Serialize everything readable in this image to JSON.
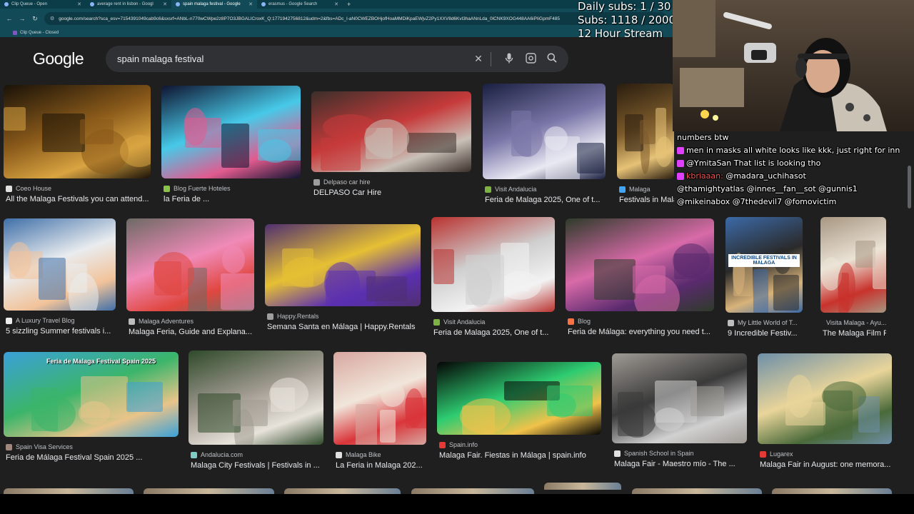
{
  "browser": {
    "tabs": [
      {
        "label": "Clip Queue - Open",
        "active": false
      },
      {
        "label": "average rent in lisbon - Googl",
        "active": false
      },
      {
        "label": "spain malaga festival - Google",
        "active": true
      },
      {
        "label": "erasmus - Google Search",
        "active": false
      }
    ],
    "new_tab": "+",
    "url": "google.com/search?sca_esv=7154391049cab9c6&sxsrf=ANbL-n770wCWpe2z8P7O3JBGALICroxK_Q:1771942756812&udm=2&fbs=ADc_l-aN0CWEZBOHjofHoaMMDiKpaEWjvZ2Py1XXV8d6Kvl3haANnLda_0lCNK9XOG448AA6iPIiGpmF485",
    "bookmark": "Clip Queue - Closed"
  },
  "google": {
    "logo": "Google",
    "query": "spain malaga festival",
    "icons": {
      "clear": "close-icon",
      "voice": "mic-icon",
      "lens": "lens-icon",
      "search": "search-icon"
    }
  },
  "results": [
    {
      "source": "Coeo House",
      "title": "All the Malaga Festivals you can attend...",
      "fav": "#e0e0e0"
    },
    {
      "source": "Blog Fuerte Hoteles",
      "title": "la Feria de ...",
      "fav": "#8bc34a"
    },
    {
      "source": "Delpaso car hire",
      "title": "DELPASO Car Hire",
      "fav": "#9e9e9e"
    },
    {
      "source": "Visit Andalucia",
      "title": "Feria de Malaga 2025, One of t...",
      "fav": "#7cb342"
    },
    {
      "source": "Malaga",
      "title": "Festivals in Malaga: Celebrate the Costa del Sol ...",
      "fav": "#42a5f5"
    },
    {
      "source": "A Luxury Travel Blog",
      "title": "5 sizzling Summer festivals i...",
      "fav": "#eeeeee"
    },
    {
      "source": "Malaga Adventures",
      "title": "Malaga Feria, Guide and Explana...",
      "fav": "#bdbdbd"
    },
    {
      "source": "Happy.Rentals",
      "title": "Semana Santa en Málaga | Happy.Rentals",
      "fav": "#9e9e9e"
    },
    {
      "source": "Visit Andalucia",
      "title": "Feria de Malaga 2025, One of t...",
      "fav": "#7cb342"
    },
    {
      "source": "Blog",
      "title": "Feria de Málaga: everything you need t...",
      "fav": "#ff7043"
    },
    {
      "source": "My Little World of T...",
      "title": "9 Incredible Festiv...",
      "fav": "#bdbdbd"
    },
    {
      "source": "Visita Malaga - Ayu...",
      "title": "The Malaga Film F...",
      "fav": "#e0e0e0"
    },
    {
      "source": "Spain Visa Services",
      "title": "Feria de Málaga Festival Spain 2025 ...",
      "fav": "#a1887f"
    },
    {
      "source": "Andalucia.com",
      "title": "Malaga City Festivals | Festivals in ...",
      "fav": "#80cbc4"
    },
    {
      "source": "Malaga Bike",
      "title": "La Feria in Malaga 202...",
      "fav": "#e0e0e0"
    },
    {
      "source": "Spain.info",
      "title": "Malaga Fair. Fiestas in Málaga | spain.info",
      "fav": "#e53935"
    },
    {
      "source": "Spanish School in Spain",
      "title": "Malaga Fair - Maestro mío - The ...",
      "fav": "#e0e0e0"
    },
    {
      "source": "Lugarex",
      "title": "Malaga Fair in August: one memora...",
      "fav": "#e53935"
    }
  ],
  "thumb_captions": {
    "feria_sign": "Feria de Malaga Festival Spain 2025",
    "incredible": "INCREDIBLE FESTIVALS IN MALAGA"
  },
  "stream": {
    "daily_subs": "Daily subs: 1 / 30",
    "subs": "Subs: 1118 / 2000",
    "hours": "12 Hour Stream"
  },
  "chat": [
    {
      "user": "",
      "text": "numbers btw"
    },
    {
      "user": "",
      "text": "men in masks all white looks like kkk, just right for innes"
    },
    {
      "user": "",
      "text": "@YmitaSan That list is looking tho"
    },
    {
      "user": "kbriaaan:",
      "text": "@madara_uchihasot"
    },
    {
      "user": "",
      "text": "@thamightyatlas @innes__fan__sot @gunnis1"
    },
    {
      "user": "",
      "text": "@mikeinabox @7thedevil7 @fomovictim"
    }
  ]
}
